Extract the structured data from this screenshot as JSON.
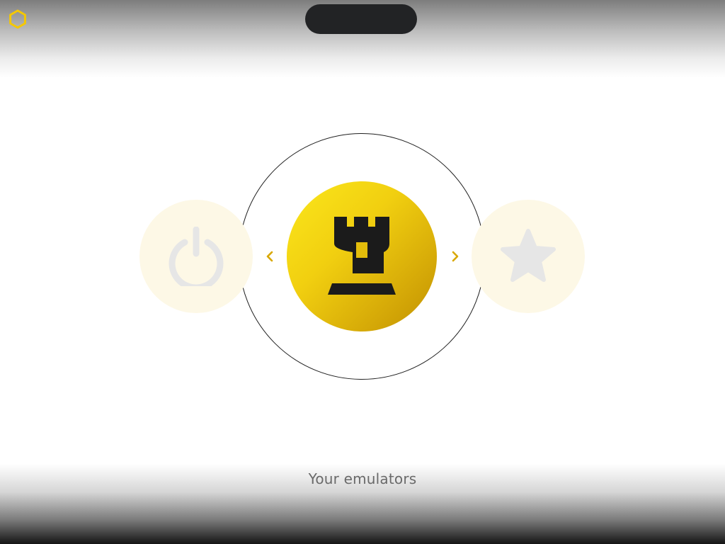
{
  "header": {
    "logo_icon": "hexagon-icon",
    "pill_label": ""
  },
  "carousel": {
    "items": [
      {
        "icon": "power-icon",
        "state": "inactive"
      },
      {
        "icon": "rook-tower-icon",
        "state": "selected"
      },
      {
        "icon": "star-icon",
        "state": "inactive"
      }
    ],
    "prev_icon": "chevron-left-icon",
    "next_icon": "chevron-right-icon"
  },
  "footer": {
    "caption": "Your emulators"
  },
  "colors": {
    "accent": "#f5d20f",
    "accent_dark": "#c08f00",
    "inactive_bg": "#fdf8e6",
    "inactive_icon": "#e6e6e6",
    "pill": "#222325",
    "caption_text": "#6a6a6a"
  }
}
